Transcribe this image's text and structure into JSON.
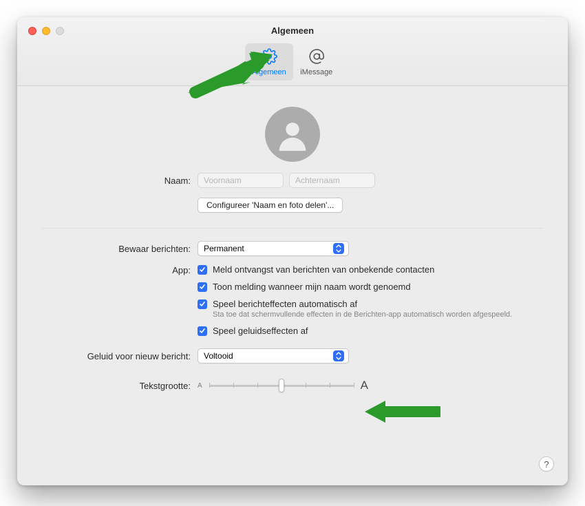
{
  "window": {
    "title": "Algemeen"
  },
  "tabs": {
    "general": {
      "label": "Algemeen"
    },
    "imessage": {
      "label": "iMessage"
    }
  },
  "profile": {
    "name_label": "Naam:",
    "firstname_placeholder": "Voornaam",
    "lastname_placeholder": "Achternaam",
    "configure_button": "Configureer 'Naam en foto delen'..."
  },
  "keep_messages": {
    "label": "Bewaar berichten:",
    "value": "Permanent"
  },
  "app_section": {
    "label": "App:",
    "unknown_contacts": "Meld ontvangst van berichten van onbekende contacten",
    "name_mentioned": "Toon melding wanneer mijn naam wordt genoemd",
    "effects_auto": "Speel berichteffecten automatisch af",
    "effects_subtext": "Sta toe dat schermvullende effecten in de Berichten-app automatisch worden afgespeeld.",
    "sound_effects": "Speel geluidseffecten af"
  },
  "sound_new": {
    "label": "Geluid voor nieuw bericht:",
    "value": "Voltooid"
  },
  "text_size": {
    "label": "Tekstgrootte:",
    "min": "A",
    "max": "A"
  },
  "help": {
    "label": "?"
  }
}
